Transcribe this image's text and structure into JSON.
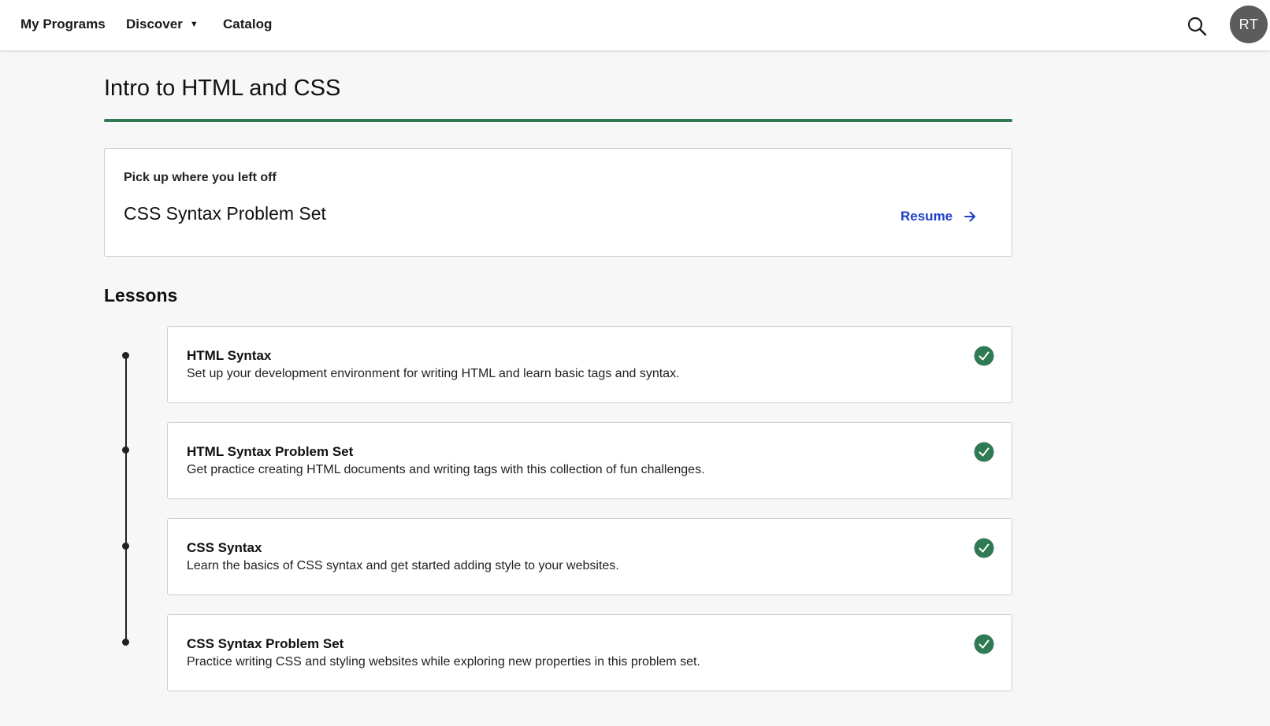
{
  "nav": {
    "items": [
      {
        "label": "My Programs"
      },
      {
        "label": "Discover"
      },
      {
        "label": "Catalog"
      }
    ],
    "avatar_initials": "RT"
  },
  "page": {
    "title": "Intro to HTML and CSS"
  },
  "resume": {
    "kicker": "Pick up where you left off",
    "lesson": "CSS Syntax Problem Set",
    "link_label": "Resume"
  },
  "lessons_section": {
    "title": "Lessons",
    "items": [
      {
        "title": "HTML Syntax",
        "description": "Set up your development environment for writing HTML and learn basic tags and syntax.",
        "completed": true
      },
      {
        "title": "HTML Syntax Problem Set",
        "description": "Get practice creating HTML documents and writing tags with this collection of fun challenges.",
        "completed": true
      },
      {
        "title": "CSS Syntax",
        "description": "Learn the basics of CSS syntax and get started adding style to your websites.",
        "completed": true
      },
      {
        "title": "CSS Syntax Problem Set",
        "description": "Practice writing CSS and styling websites while exploring new properties in this problem set.",
        "completed": true
      }
    ]
  },
  "colors": {
    "accent_green": "#2f7a52",
    "link_blue": "#1d3fcc",
    "avatar_bg": "#5c5c5c"
  },
  "icons": {
    "search": "search-icon",
    "discover_caret": "caret-down-icon",
    "resume_arrow": "arrow-right-icon",
    "lesson_status": "check-circle-icon"
  }
}
